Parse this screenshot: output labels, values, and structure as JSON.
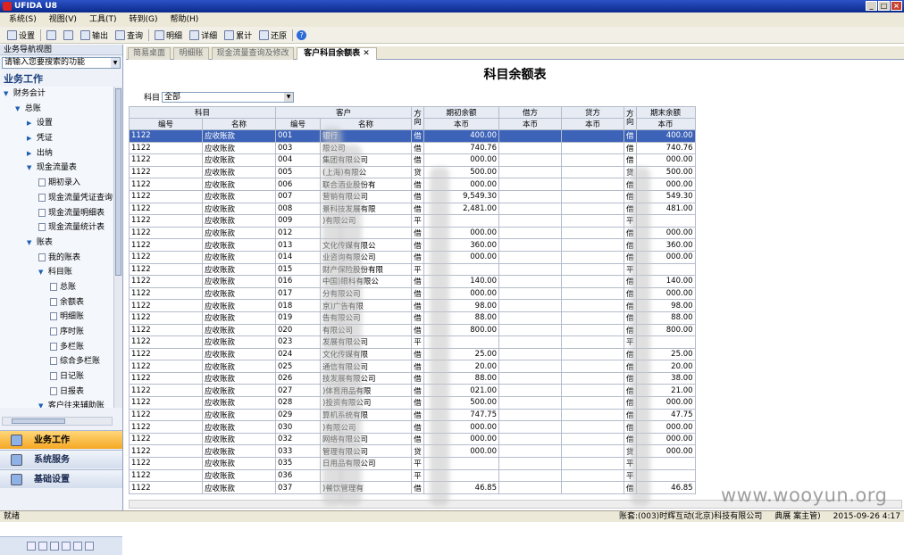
{
  "app": {
    "title": "UFIDA U8"
  },
  "menu": [
    "系统(S)",
    "视图(V)",
    "工具(T)",
    "转到(G)",
    "帮助(H)"
  ],
  "toolbar": [
    {
      "label": "设置",
      "icon": "settings-icon"
    },
    {
      "label": "",
      "icon": "print-icon"
    },
    {
      "label": "",
      "icon": "preview-icon"
    },
    {
      "label": "输出",
      "icon": "export-icon"
    },
    {
      "label": "查询",
      "icon": "query-icon"
    },
    {
      "label": "明细",
      "icon": "detail-icon"
    },
    {
      "label": "详细",
      "icon": "detailed-icon"
    },
    {
      "label": "累计",
      "icon": "cumulative-icon"
    },
    {
      "label": "还原",
      "icon": "restore-icon"
    }
  ],
  "nav": {
    "header": "业务导航视图",
    "search_placeholder": "请输入您要搜索的功能",
    "section_title": "业务工作",
    "tree": [
      {
        "label": "财务会计",
        "level": 0,
        "type": "group"
      },
      {
        "label": "总账",
        "level": 1,
        "type": "group"
      },
      {
        "label": "设置",
        "level": 2,
        "type": "collapsed"
      },
      {
        "label": "凭证",
        "level": 2,
        "type": "collapsed"
      },
      {
        "label": "出纳",
        "level": 2,
        "type": "collapsed"
      },
      {
        "label": "现金流量表",
        "level": 2,
        "type": "group"
      },
      {
        "label": "期初录入",
        "level": 3,
        "type": "doc"
      },
      {
        "label": "现金流量凭证查询",
        "level": 3,
        "type": "doc"
      },
      {
        "label": "现金流量明细表",
        "level": 3,
        "type": "doc"
      },
      {
        "label": "现金流量统计表",
        "level": 3,
        "type": "doc"
      },
      {
        "label": "账表",
        "level": 2,
        "type": "group"
      },
      {
        "label": "我的账表",
        "level": 3,
        "type": "doc"
      },
      {
        "label": "科目账",
        "level": 3,
        "type": "group"
      },
      {
        "label": "总账",
        "level": 4,
        "type": "doc"
      },
      {
        "label": "余额表",
        "level": 4,
        "type": "doc"
      },
      {
        "label": "明细账",
        "level": 4,
        "type": "doc"
      },
      {
        "label": "序时账",
        "level": 4,
        "type": "doc"
      },
      {
        "label": "多栏账",
        "level": 4,
        "type": "doc"
      },
      {
        "label": "综合多栏账",
        "level": 4,
        "type": "doc"
      },
      {
        "label": "日记账",
        "level": 4,
        "type": "doc"
      },
      {
        "label": "日报表",
        "level": 4,
        "type": "doc"
      },
      {
        "label": "客户往来辅助账",
        "level": 3,
        "type": "group"
      }
    ],
    "modules": [
      "业务工作",
      "系统服务",
      "基础设置"
    ]
  },
  "tabs": [
    "简易桌面",
    "明细账",
    "现金流量查询及修改",
    "客户科目余额表"
  ],
  "report": {
    "title": "科目余额表",
    "filter_label": "科目",
    "filter_value": "全部",
    "group_headers": [
      "科目",
      "客户",
      "方向",
      "期初余额",
      "借方",
      "贷方",
      "方向",
      "期末余额"
    ],
    "sub_headers": [
      "编号",
      "名称",
      "编号",
      "名称",
      "本币",
      "本币",
      "本币",
      "本币"
    ],
    "rows": [
      [
        "1122",
        "应收账款",
        "001",
        "银行",
        "借",
        "400.00",
        "",
        "",
        "借",
        "400.00"
      ],
      [
        "1122",
        "应收账款",
        "003",
        "限公司",
        "借",
        "740.76",
        "",
        "",
        "借",
        "740.76"
      ],
      [
        "1122",
        "应收账款",
        "004",
        "集团有限公司",
        "借",
        "000.00",
        "",
        "",
        "借",
        "000.00"
      ],
      [
        "1122",
        "应收账款",
        "005",
        "(上海)有限公",
        "贷",
        "500.00",
        "",
        "",
        "贷",
        "500.00"
      ],
      [
        "1122",
        "应收账款",
        "006",
        "联合酒业股份有",
        "借",
        "000.00",
        "",
        "",
        "借",
        "000.00"
      ],
      [
        "1122",
        "应收账款",
        "007",
        "营销有限公司",
        "借",
        "9,549.30",
        "",
        "",
        "借",
        "549.30"
      ],
      [
        "1122",
        "应收账款",
        "008",
        "景科技发展有限",
        "借",
        "2,481.00",
        "",
        "",
        "借",
        "481.00"
      ],
      [
        "1122",
        "应收账款",
        "009",
        ")有限公司",
        "平",
        "",
        "",
        "",
        "平",
        ""
      ],
      [
        "1122",
        "应收账款",
        "012",
        "",
        "借",
        "000.00",
        "",
        "",
        "借",
        "000.00"
      ],
      [
        "1122",
        "应收账款",
        "013",
        "文化传媒有限公",
        "借",
        "360.00",
        "",
        "",
        "借",
        "360.00"
      ],
      [
        "1122",
        "应收账款",
        "014",
        "业咨询有限公司",
        "借",
        "000.00",
        "",
        "",
        "借",
        "000.00"
      ],
      [
        "1122",
        "应收账款",
        "015",
        "财产保险股份有限",
        "平",
        "",
        "",
        "",
        "平",
        ""
      ],
      [
        "1122",
        "应收账款",
        "016",
        "中国)眼科有限公",
        "借",
        "140.00",
        "",
        "",
        "借",
        "140.00"
      ],
      [
        "1122",
        "应收账款",
        "017",
        "分有限公司",
        "借",
        "000.00",
        "",
        "",
        "借",
        "000.00"
      ],
      [
        "1122",
        "应收账款",
        "018",
        "京)广告有限",
        "借",
        "98.00",
        "",
        "",
        "借",
        "98.00"
      ],
      [
        "1122",
        "应收账款",
        "019",
        "告有限公司",
        "借",
        "88.00",
        "",
        "",
        "借",
        "88.00"
      ],
      [
        "1122",
        "应收账款",
        "020",
        "有限公司",
        "借",
        "800.00",
        "",
        "",
        "借",
        "800.00"
      ],
      [
        "1122",
        "应收账款",
        "023",
        "发展有限公司",
        "平",
        "",
        "",
        "",
        "平",
        ""
      ],
      [
        "1122",
        "应收账款",
        "024",
        "文化传媒有限",
        "借",
        "25.00",
        "",
        "",
        "借",
        "25.00"
      ],
      [
        "1122",
        "应收账款",
        "025",
        "通信有限公司",
        "借",
        "20.00",
        "",
        "",
        "借",
        "20.00"
      ],
      [
        "1122",
        "应收账款",
        "026",
        "技发展有限公司",
        "借",
        "88.00",
        "",
        "",
        "借",
        "38.00"
      ],
      [
        "1122",
        "应收账款",
        "027",
        ")体育用品有限",
        "借",
        "021.00",
        "",
        "",
        "借",
        "21.00"
      ],
      [
        "1122",
        "应收账款",
        "028",
        ")投资有限公司",
        "借",
        "500.00",
        "",
        "",
        "借",
        "000.00"
      ],
      [
        "1122",
        "应收账款",
        "029",
        "算机系统有限",
        "借",
        "747.75",
        "",
        "",
        "借",
        "47.75"
      ],
      [
        "1122",
        "应收账款",
        "030",
        ")有限公司",
        "借",
        "000.00",
        "",
        "",
        "借",
        "000.00"
      ],
      [
        "1122",
        "应收账款",
        "032",
        "网络有限公司",
        "借",
        "000.00",
        "",
        "",
        "借",
        "000.00"
      ],
      [
        "1122",
        "应收账款",
        "033",
        "管理有限公司",
        "贷",
        "000.00",
        "",
        "",
        "贷",
        "000.00"
      ],
      [
        "1122",
        "应收账款",
        "035",
        "日用品有限公司",
        "平",
        "",
        "",
        "",
        "平",
        ""
      ],
      [
        "1122",
        "应收账款",
        "036",
        "",
        "平",
        "",
        "",
        "",
        "平",
        ""
      ],
      [
        "1122",
        "应收账款",
        "037",
        ")餐饮管理有",
        "借",
        "46.85",
        "",
        "",
        "借",
        "46.85"
      ]
    ]
  },
  "status": {
    "left": "就绪",
    "account": "账套:(003)时辉互动(北京)科技有限公司",
    "user": "典展",
    "user_suffix": "案主管)",
    "datetime": "2015-09-26 4:17"
  },
  "watermark": "www.wooyun.org"
}
